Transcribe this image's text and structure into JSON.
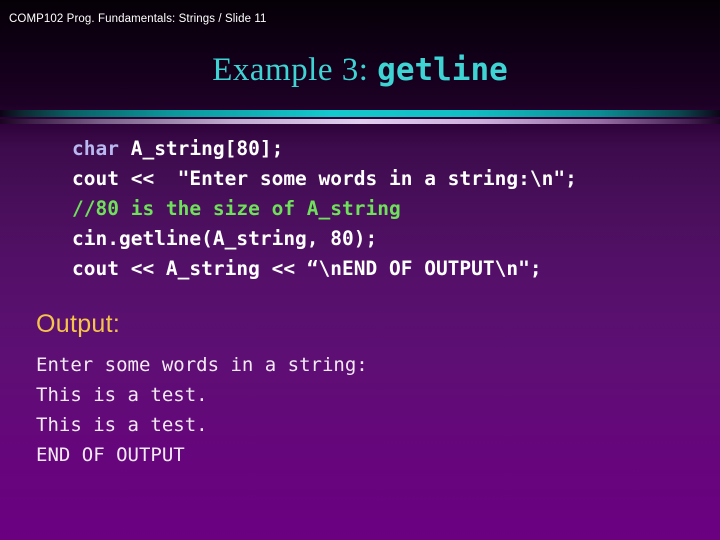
{
  "slide": {
    "header": "COMP102 Prog. Fundamentals: Strings / Slide 11",
    "title_serif_part": "Example 3: ",
    "title_mono_part": "getline",
    "output_label": "Output:",
    "colors": {
      "title_teal": "#3fd4d4",
      "keyword_lavender": "#b9b8f0",
      "comment_green": "#6ee05a",
      "output_label_gold": "#f5c44a",
      "code_white": "#ffffff",
      "background_top": "#050006",
      "background_bottom": "#6b0081"
    }
  },
  "code_lines": [
    {
      "keyword": "char",
      "rest": " A_string[80];",
      "comment": false
    },
    {
      "keyword": "",
      "rest": "cout <<  \"Enter some words in a string:\\n\";",
      "comment": false
    },
    {
      "keyword": "",
      "rest": "//80 is the size of A_string",
      "comment": true
    },
    {
      "keyword": "",
      "rest": "cin.getline(A_string, 80);",
      "comment": false
    },
    {
      "keyword": "",
      "rest": "cout << A_string << “\\nEND OF OUTPUT\\n\";",
      "comment": false
    }
  ],
  "console_lines": [
    "Enter some words in a string:",
    "This is a test.",
    "This is a test.",
    "END OF OUTPUT"
  ]
}
